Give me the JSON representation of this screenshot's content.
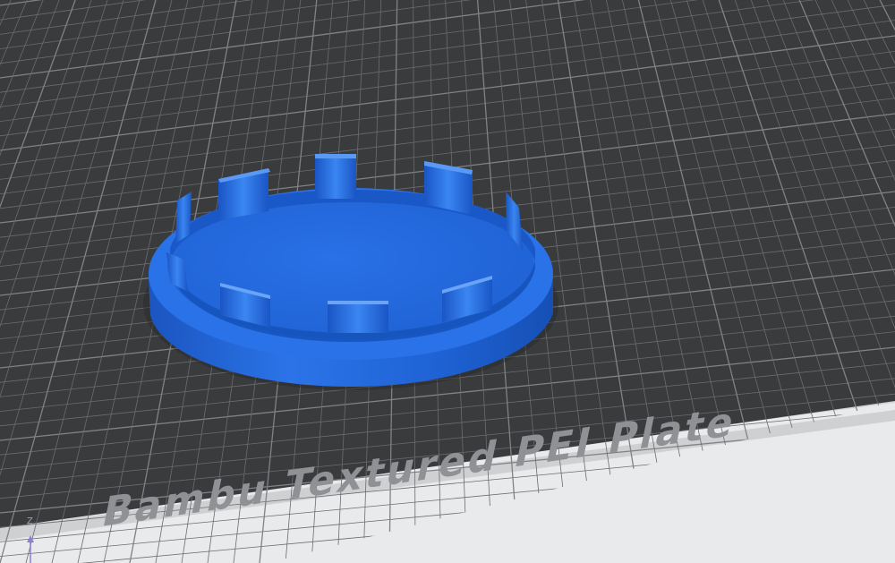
{
  "viewport": {
    "plate_label": "Bambu Textured PEI Plate",
    "axis_z_label": "Z",
    "colors": {
      "background": "#d2d4d6",
      "plate": "#3a3b3d",
      "grid_line": "#6a6c6f",
      "grid_major": "#808286",
      "plate_label": "#8f9194",
      "plate_edge": "#e8e9ea",
      "model": "#1f63d6",
      "model_shadow": "#1346a8",
      "model_highlight": "#3b82f0",
      "axis_z": "#8a7fd8"
    }
  }
}
